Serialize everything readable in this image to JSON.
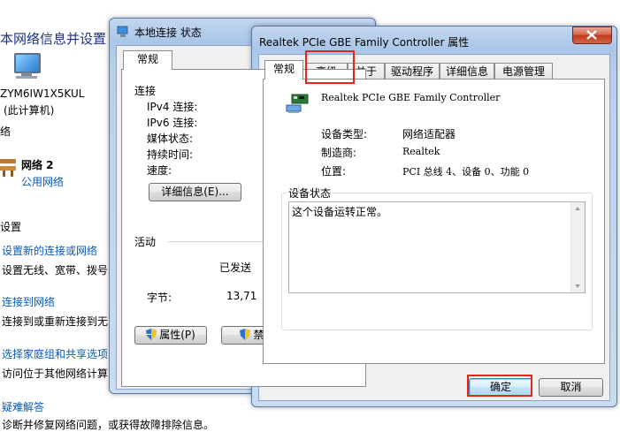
{
  "background_window": {
    "title": "本网络信息并设置",
    "computer_name": "ZYM6IW1X5KUL",
    "computer_caption": "(此计算机)",
    "network_section_label": "络",
    "network_name": "网络  2",
    "network_type_link": "公用网络",
    "settings_section_label": "设置",
    "items": [
      {
        "link": "设置新的连接或网络",
        "desc": "设置无线、宽带、拨号"
      },
      {
        "link": "连接到网络",
        "desc": "连接到或重新连接到无"
      },
      {
        "link": "选择家庭组和共享选项",
        "desc": "访问位于其他网络计算"
      },
      {
        "link": "疑难解答",
        "desc": "诊断并修复网络问题，或获得故障排除信息。"
      }
    ]
  },
  "status_dialog": {
    "title": "本地连接 状态",
    "tab_general": "常规",
    "connection_heading": "连接",
    "fields": [
      "IPv4 连接:",
      "IPv6 连接:",
      "媒体状态:",
      "持续时间:",
      "速度:"
    ],
    "details_button": "详细信息(E)...",
    "activity_heading": "活动",
    "sent_label": "已发送",
    "bytes_label": "字节:",
    "bytes_value": "13,71",
    "properties_button": "属性(P)",
    "disable_button": "禁用"
  },
  "props_dialog": {
    "title": "Realtek PCIe GBE Family Controller 属性",
    "tabs": [
      "常规",
      "高级",
      "关于",
      "驱动程序",
      "详细信息",
      "电源管理"
    ],
    "device_name": "Realtek PCIe GBE Family Controller",
    "device_type_label": "设备类型:",
    "device_type_value": "网络适配器",
    "manufacturer_label": "制造商:",
    "manufacturer_value": "Realtek",
    "location_label": "位置:",
    "location_value": "PCI 总线 4、设备 0、功能 0",
    "status_group_label": "设备状态",
    "status_text": "这个设备运转正常。",
    "ok_button": "确定",
    "cancel_button": "取消"
  },
  "colors": {
    "highlight": "#e8231b",
    "link": "#0b5ab4",
    "title_blue": "#1e3287"
  }
}
